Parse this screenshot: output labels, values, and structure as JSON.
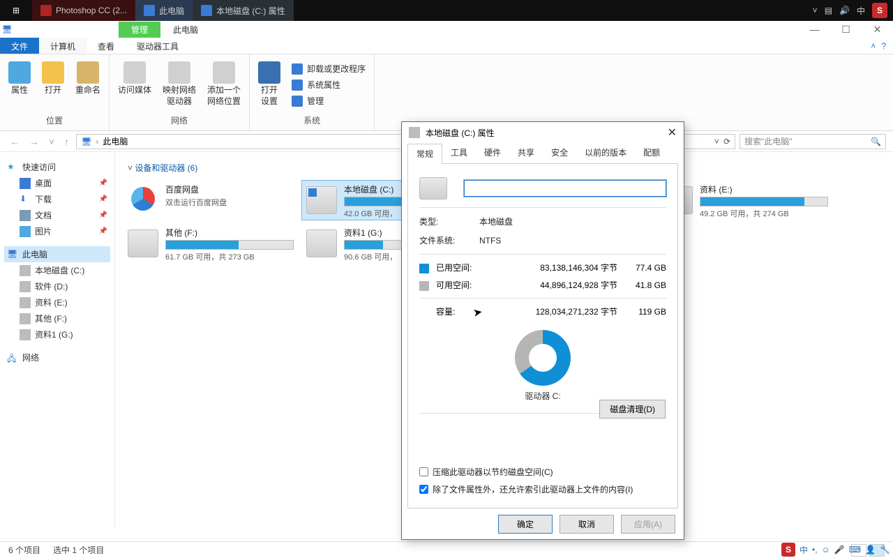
{
  "taskbar": {
    "apps": [
      "Photoshop CC (2...",
      "此电脑",
      "本地磁盘 (C:) 属性"
    ],
    "ime": "中"
  },
  "titlebar": {
    "active": "管理",
    "inactive": "此电脑"
  },
  "ribtabs": {
    "file": "文件",
    "computer": "计算机",
    "view": "查看",
    "drivetools": "驱动器工具"
  },
  "ribbon": {
    "loc": {
      "prop": "属性",
      "open": "打开",
      "rename": "重命名",
      "group": "位置"
    },
    "net": {
      "media": "访问媒体",
      "map": "映射网络\n驱动器",
      "addloc": "添加一个\n网络位置",
      "group": "网络"
    },
    "sys": {
      "opensettings": "打开\n设置",
      "uninstall": "卸载或更改程序",
      "sysprop": "系统属性",
      "manage": "管理",
      "group": "系统"
    }
  },
  "addr": {
    "location": "此电脑",
    "search_ph": "搜索\"此电脑\""
  },
  "tree": {
    "quick": "快速访问",
    "desktop": "桌面",
    "downloads": "下载",
    "docs": "文档",
    "pics": "图片",
    "thispc": "此电脑",
    "c": "本地磁盘 (C:)",
    "d": "软件 (D:)",
    "e": "资料 (E:)",
    "f": "其他 (F:)",
    "g": "资料1 (G:)",
    "network": "网络"
  },
  "section": "设备和驱动器 (6)",
  "drives": {
    "baidu": {
      "name": "百度网盘",
      "sub": "双击运行百度网盘"
    },
    "c": {
      "name": "本地磁盘 (C:)",
      "sub": "42.0 GB 可用，",
      "fill": 65
    },
    "e": {
      "name": "资料 (E:)",
      "sub": "49.2 GB 可用，共 274 GB",
      "fill": 82
    },
    "f": {
      "name": "其他 (F:)",
      "sub": "61.7 GB 可用，共 273 GB",
      "fill": 57
    },
    "g": {
      "name": "资料1 (G:)",
      "sub": "90.6 GB 可用，",
      "fill": 30
    }
  },
  "status": {
    "items": "6 个项目",
    "selected": "选中 1 个项目"
  },
  "dialog": {
    "title": "本地磁盘 (C:) 属性",
    "tabs": {
      "general": "常规",
      "tools": "工具",
      "hardware": "硬件",
      "sharing": "共享",
      "security": "安全",
      "prev": "以前的版本",
      "quota": "配额"
    },
    "type_k": "类型:",
    "type_v": "本地磁盘",
    "fs_k": "文件系统:",
    "fs_v": "NTFS",
    "used_k": "已用空间:",
    "used_b": "83,138,146,304 字节",
    "used_g": "77.4 GB",
    "free_k": "可用空间:",
    "free_b": "44,896,124,928 字节",
    "free_g": "41.8 GB",
    "cap_k": "容量:",
    "cap_b": "128,034,271,232 字节",
    "cap_g": "119 GB",
    "drive_label": "驱动器 C:",
    "cleanup": "磁盘清理(D)",
    "compress": "压缩此驱动器以节约磁盘空间(C)",
    "index": "除了文件属性外，还允许索引此驱动器上文件的内容(I)",
    "ok": "确定",
    "cancel": "取消",
    "apply": "应用(A)"
  }
}
